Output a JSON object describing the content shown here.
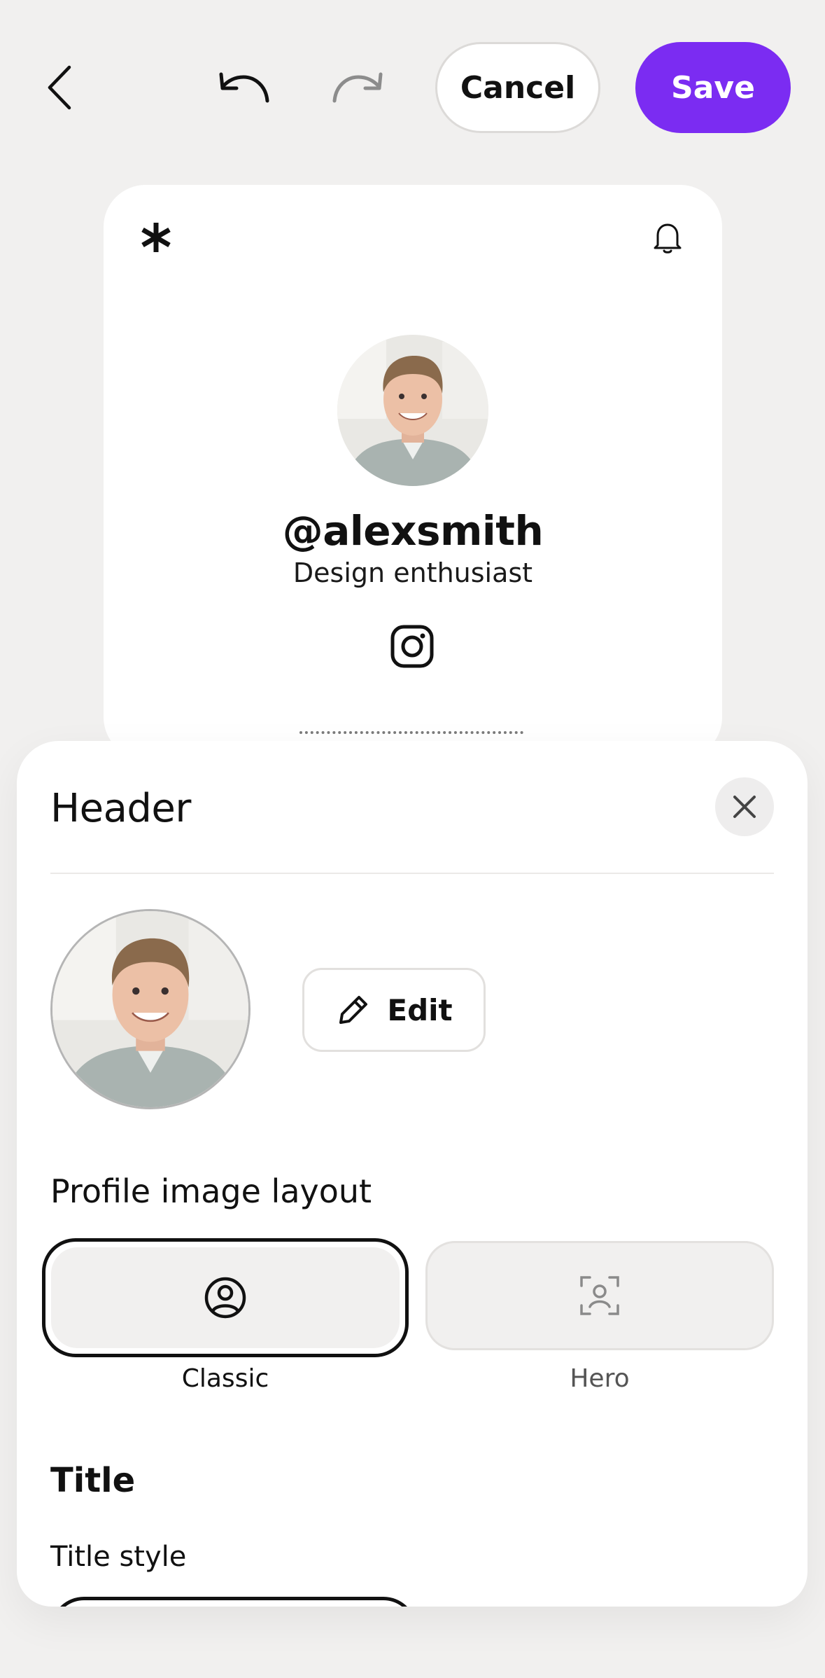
{
  "toolbar": {
    "back_icon": "chevron-left-icon",
    "undo_icon": "undo-icon",
    "redo_icon": "redo-icon",
    "cancel_label": "Cancel",
    "save_label": "Save",
    "save_color": "#7b2cf2"
  },
  "preview": {
    "logo_icon": "asterisk-logo-icon",
    "notification_icon": "bell-icon",
    "handle": "@alexsmith",
    "bio": "Design enthusiast",
    "social_icon": "instagram-icon"
  },
  "sheet": {
    "title": "Header",
    "close_icon": "close-icon",
    "edit_label": "Edit",
    "edit_icon": "pencil-icon",
    "profile_image_layout": {
      "label": "Profile image layout",
      "options": [
        {
          "label": "Classic",
          "icon": "user-circle-icon",
          "selected": true
        },
        {
          "label": "Hero",
          "icon": "user-focus-icon",
          "selected": false
        }
      ]
    },
    "title_section": {
      "heading": "Title",
      "style_label": "Title style"
    }
  }
}
